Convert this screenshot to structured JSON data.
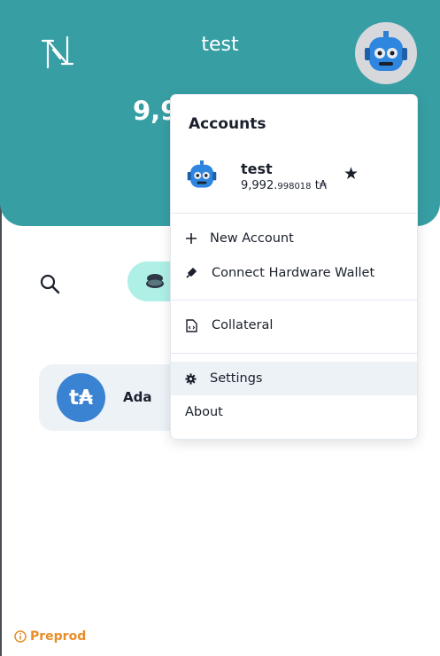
{
  "header": {
    "account_name": "test",
    "balance_visible": "9,9"
  },
  "menu": {
    "title": "Accounts",
    "accounts": [
      {
        "name": "test",
        "balance_int": "9,992.",
        "balance_dec": "998018",
        "unit": "t₳"
      }
    ],
    "items": {
      "new_account": "New Account",
      "hardware_wallet": "Connect Hardware Wallet",
      "collateral": "Collateral",
      "settings": "Settings",
      "about": "About"
    }
  },
  "assets": [
    {
      "symbol": "t₳",
      "name": "Ada"
    }
  ],
  "network": {
    "label": "Preprod"
  },
  "colors": {
    "header": "#379fa4",
    "accent_tab": "#aef0e6",
    "ada": "#3a82d2",
    "network": "#e88d28"
  }
}
